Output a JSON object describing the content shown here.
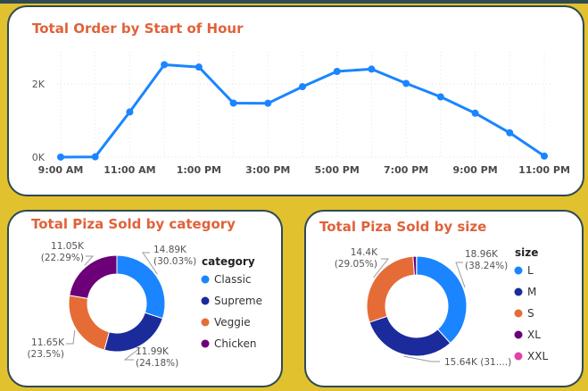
{
  "chart_data": [
    {
      "type": "line",
      "title": "Total Order by Start of Hour",
      "x_tick_labels": [
        "9:00 AM",
        "11:00 AM",
        "1:00 PM",
        "3:00 PM",
        "5:00 PM",
        "7:00 PM",
        "9:00 PM",
        "11:00 PM"
      ],
      "x": [
        "9:00 AM",
        "10:00 AM",
        "11:00 AM",
        "12:00 PM",
        "1:00 PM",
        "2:00 PM",
        "3:00 PM",
        "4:00 PM",
        "5:00 PM",
        "6:00 PM",
        "7:00 PM",
        "8:00 PM",
        "9:00 PM",
        "10:00 PM",
        "11:00 PM"
      ],
      "values": [
        1,
        8,
        1231,
        2520,
        2455,
        1472,
        1468,
        1920,
        2336,
        2399,
        2009,
        1642,
        1198,
        663,
        28
      ],
      "y_tick_labels": [
        "0K",
        "2K"
      ],
      "ylim": [
        0,
        2750
      ],
      "color": "#1a85ff",
      "grid": true
    },
    {
      "type": "pie",
      "title": "Total Piza Sold by category",
      "legend_title": "category",
      "categories": [
        "Classic",
        "Supreme",
        "Veggie",
        "Chicken"
      ],
      "values": [
        14888,
        11987,
        11649,
        11050
      ],
      "data_labels": [
        "14.89K\n(30.03%)",
        "11.99K\n(24.18%)",
        "11.65K\n(23.5%)",
        "11.05K\n(22.29%)"
      ],
      "colors": [
        "#1a85ff",
        "#1b2b9b",
        "#e56c37",
        "#6b0078"
      ],
      "legend_placement": "right"
    },
    {
      "type": "pie",
      "title": "Total Piza Sold by size",
      "legend_title": "size",
      "categories": [
        "L",
        "M",
        "S",
        "XL",
        "XXL"
      ],
      "values": [
        18956,
        15635,
        14403,
        552,
        28
      ],
      "data_labels": [
        "18.96K\n(38.24%)",
        "15.64K (31....)",
        "14.4K\n(29.05%)",
        "",
        ""
      ],
      "colors": [
        "#1a85ff",
        "#1b2b9b",
        "#e56c37",
        "#6b0078",
        "#e044a7"
      ],
      "legend_placement": "right"
    }
  ]
}
